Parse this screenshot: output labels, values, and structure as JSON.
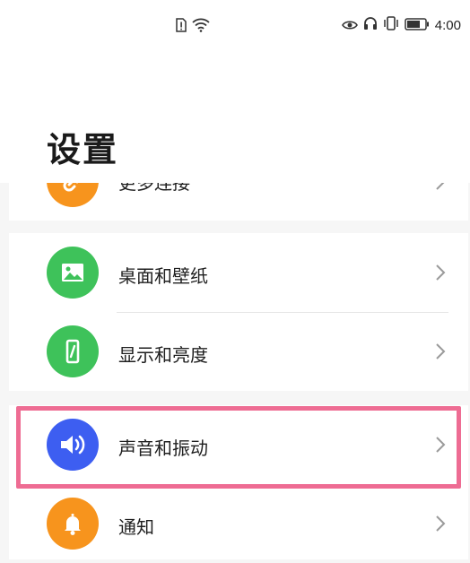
{
  "status_bar": {
    "time": "4:00",
    "left_icons": [
      "sim-alert-icon",
      "wifi-icon"
    ],
    "right_icons": [
      "eye-icon",
      "headphones-icon",
      "vibrate-icon",
      "battery-icon"
    ]
  },
  "page": {
    "title": "设置"
  },
  "items": [
    {
      "label": "更多连接",
      "icon": "link-icon",
      "color": "#f7941d"
    },
    {
      "label": "桌面和壁纸",
      "icon": "image-icon",
      "color": "#3ec25a"
    },
    {
      "label": "显示和亮度",
      "icon": "phone-display-icon",
      "color": "#3ec25a"
    },
    {
      "label": "声音和振动",
      "icon": "speaker-icon",
      "color": "#3d5ef1",
      "highlighted": true
    },
    {
      "label": "通知",
      "icon": "bell-icon",
      "color": "#f7941d"
    }
  ],
  "highlight_color": "#ee6c93"
}
